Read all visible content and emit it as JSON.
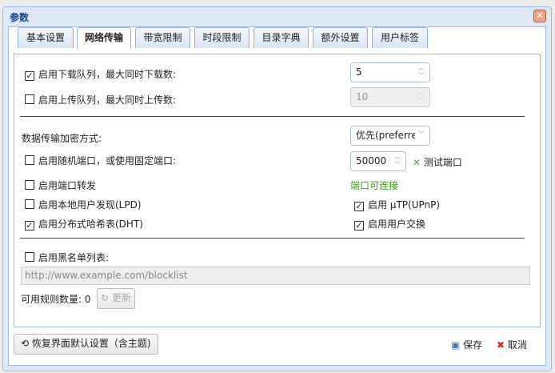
{
  "window": {
    "title": "参数"
  },
  "tabs": [
    "基本设置",
    "网络传输",
    "带宽限制",
    "时段限制",
    "目录字典",
    "额外设置",
    "用户标签"
  ],
  "download_queue": {
    "label": "启用下载队列，最大同时下载数:",
    "checked": true,
    "value": "5"
  },
  "upload_queue": {
    "label": "启用上传队列，最大同时上传数:",
    "checked": false,
    "value": "10"
  },
  "encryption": {
    "label": "数据传输加密方式:",
    "value": "优先(preferre"
  },
  "random_port": {
    "label": "启用随机端口，或使用固定端口:",
    "checked": false,
    "value": "50000"
  },
  "test_port": {
    "label": "测试端口"
  },
  "port_forward": {
    "label": "启用端口转发",
    "checked": false
  },
  "port_status": {
    "text": "端口可连接",
    "color": "#3a9a1a"
  },
  "lpd": {
    "label": "启用本地用户发现(LPD)",
    "checked": false
  },
  "utp": {
    "label": "启用 µTP(UPnP)",
    "checked": true
  },
  "dht": {
    "label": "启用分布式哈希表(DHT)",
    "checked": true
  },
  "pex": {
    "label": "启用用户交换",
    "checked": true
  },
  "blocklist": {
    "label": "启用黑名单列表:",
    "checked": false,
    "url": "http://www.example.com/blocklist",
    "rules_label": "可用规则数量:",
    "rules_count": "0",
    "update": "更新"
  },
  "footer": {
    "restore": "恢复界面默认设置（含主题)",
    "save": "保存",
    "cancel": "取消"
  },
  "check_mark": "✓"
}
